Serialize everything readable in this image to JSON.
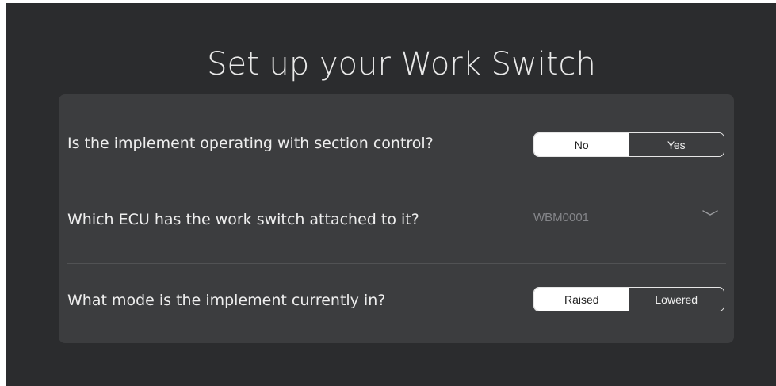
{
  "page": {
    "title": "Set up your Work Switch"
  },
  "questions": [
    {
      "text": "Is the implement operating with section control?",
      "control": "segmented",
      "options": [
        "No",
        "Yes"
      ],
      "selected": "No"
    },
    {
      "text": "Which ECU has the work switch attached to it?",
      "control": "dropdown",
      "value": "WBM0001",
      "icon": "chevron-down-icon"
    },
    {
      "text": "What mode is the implement currently in?",
      "control": "segmented",
      "options": [
        "Raised",
        "Lowered"
      ],
      "selected": "Raised"
    }
  ],
  "colors": {
    "background": "#2b2c2e",
    "card": "#3c3d3f",
    "text": "#eeeeee",
    "muted": "#85868a",
    "selected_segment": "#ffffff"
  }
}
